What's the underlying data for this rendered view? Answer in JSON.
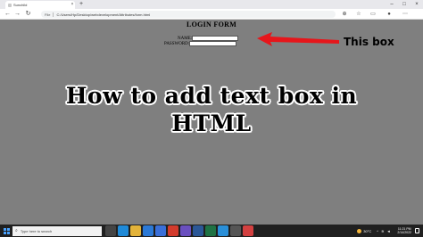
{
  "browser": {
    "tab_title": "Sunchild",
    "tab_close": "×",
    "new_tab": "+",
    "address_info": "File",
    "url": "C:/Users/Hp/Desktop/webdevelopment/Attributes/form.html",
    "back": "←",
    "forward": "→",
    "reload": "↻",
    "window_minimize": "–",
    "window_maximize": "□",
    "window_close": "×"
  },
  "form": {
    "title": "LOGIN FORM",
    "name_label": "NAME:",
    "password_label": "PASSWORD:",
    "name_value": "",
    "password_value": ""
  },
  "annotation": {
    "callout": "This box",
    "arrow_color": "#e6161b"
  },
  "overlay": {
    "line1": "How to add text box in",
    "line2": "HTML"
  },
  "taskbar": {
    "search_placeholder": "Type here to search",
    "weather": "30°C",
    "time": "11:21 PM",
    "date": "2/14/2022",
    "apps": [
      {
        "icon": "task-view-icon",
        "color": "#444444"
      },
      {
        "icon": "edge-icon",
        "color": "#1f8ad8"
      },
      {
        "icon": "file-explorer-icon",
        "color": "#e3b33a"
      },
      {
        "icon": "mail-icon",
        "color": "#2b79d6"
      },
      {
        "icon": "store-icon",
        "color": "#3a6fd8"
      },
      {
        "icon": "chrome-icon",
        "color": "#d33b2c"
      },
      {
        "icon": "photos-icon",
        "color": "#6a4fbf"
      },
      {
        "icon": "word-icon",
        "color": "#2b5797"
      },
      {
        "icon": "excel-icon",
        "color": "#1f7244"
      },
      {
        "icon": "vscode-icon",
        "color": "#2a8fd8"
      },
      {
        "icon": "obs-icon",
        "color": "#555555"
      },
      {
        "icon": "app-icon",
        "color": "#d34040"
      }
    ]
  }
}
